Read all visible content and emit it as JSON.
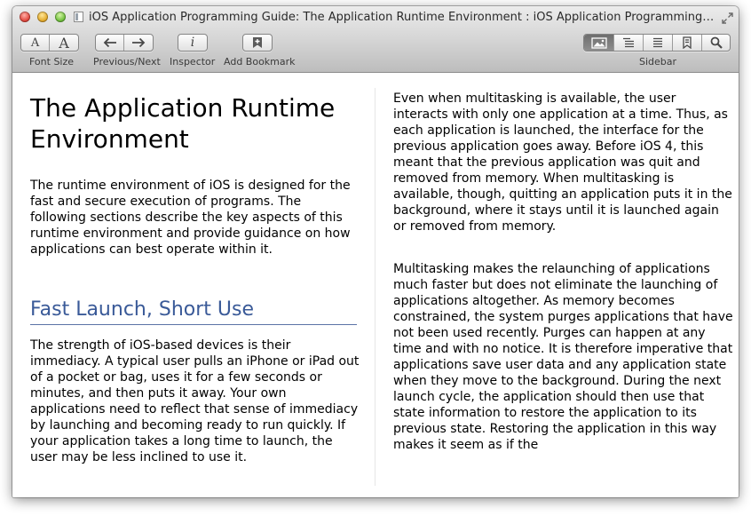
{
  "window": {
    "title": "iOS Application Programming Guide: The Application Runtime Environment : iOS Application Programming G..."
  },
  "toolbar": {
    "font_size": {
      "label": "Font Size",
      "smaller_glyph": "A",
      "larger_glyph": "A"
    },
    "prev_next": {
      "label": "Previous/Next"
    },
    "inspector": {
      "label": "Inspector",
      "glyph": "i"
    },
    "add_bookmark": {
      "label": "Add Bookmark"
    },
    "sidebar": {
      "label": "Sidebar"
    }
  },
  "article": {
    "title": "The Application Runtime Environment",
    "intro": "The runtime environment of iOS is designed for the fast and secure execution of programs. The following sections describe the key aspects of this runtime environment and provide guidance on how applications can best operate within it.",
    "section_heading": "Fast Launch, Short Use",
    "section_paragraph": "The strength of iOS-based devices is their immediacy. A typical user pulls an iPhone or iPad out of a pocket or bag, uses it for a few seconds or minutes, and then puts it away. Your own applications need to reflect that sense of immediacy by launching and becoming ready to run quickly. If your application takes a long time to launch, the user may be less inclined to use it.",
    "right_paragraph_1": "Even when multitasking is available, the user interacts with only one application at a time. Thus, as each application is launched, the interface for the previous application goes away. Before iOS 4, this meant that the previous application was quit and removed from memory. When multitasking is available, though, quitting an application puts it in the background, where it stays until it is launched again or removed from memory.",
    "right_paragraph_2": "Multitasking makes the relaunching of applications much faster but does not eliminate the launching of applications altogether. As memory becomes constrained, the system purges applications that have not been used recently. Purges can happen at any time and with no notice. It is therefore imperative that applications save user data and any application state when they move to the background. During the next launch cycle, the application should then use that state information to restore the application to its previous state. Restoring the application in this way makes it seem as if the"
  }
}
